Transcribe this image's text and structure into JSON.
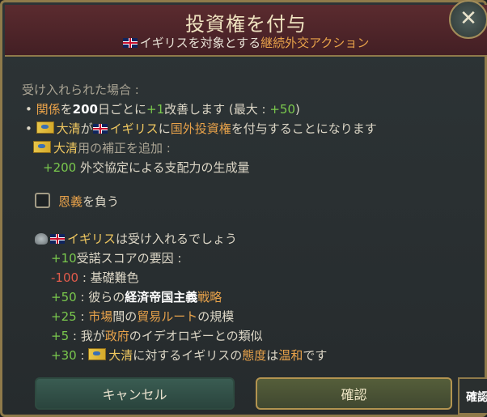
{
  "header": {
    "title": "投資権を付与",
    "subtitle_country": "イギリス",
    "subtitle_mid": "を対象とする",
    "subtitle_action": "継続外交アクション",
    "close_label": "✕"
  },
  "body": {
    "if_accepted": "受け入れられた場合 :",
    "l1": {
      "bullet": "•",
      "a": "関係",
      "b": "を",
      "c": "200",
      "d": "日ごとに",
      "e": "+1",
      "f": "改善します (最大 : ",
      "g": "+50",
      "h": ")"
    },
    "l2": {
      "bullet": "•",
      "a": "大清",
      "b": "が",
      "c": "イギリス",
      "d": "に",
      "e": "国外投資権",
      "f": "を付与することになります"
    },
    "l3": {
      "a": "大清",
      "b": "用の補正を追加 :"
    },
    "l4": {
      "a": "+200",
      "b": "外交協定による支配力の生成量"
    },
    "checkbox_a": "恩義",
    "checkbox_b": "を負う",
    "accept": {
      "a": "イギリス",
      "b": "は受け入れるでしょう"
    },
    "score": {
      "a": "+10",
      "b": "受諾スコアの要因 :"
    },
    "f1": {
      "a": "-100",
      "b": " : 基礎難色"
    },
    "f2": {
      "a": "+50",
      "b": " : 彼らの",
      "c": "経済帝国主義",
      "d": "戦略"
    },
    "f3": {
      "a": "+25",
      "b": " : ",
      "c": "市場",
      "d": "間の",
      "e": "貿易ルート",
      "f": "の規模"
    },
    "f4": {
      "a": "+5",
      "b": " : 我が",
      "c": "政府",
      "d": "のイデオロギーとの類似"
    },
    "f5": {
      "a": "+30",
      "b": " : ",
      "c": "大清",
      "d": "に対するイギリスの",
      "e": "態度",
      "f": "は",
      "g": "温和",
      "h": "です"
    }
  },
  "buttons": {
    "cancel": "キャンセル",
    "confirm": "確認",
    "extra": "確認"
  }
}
